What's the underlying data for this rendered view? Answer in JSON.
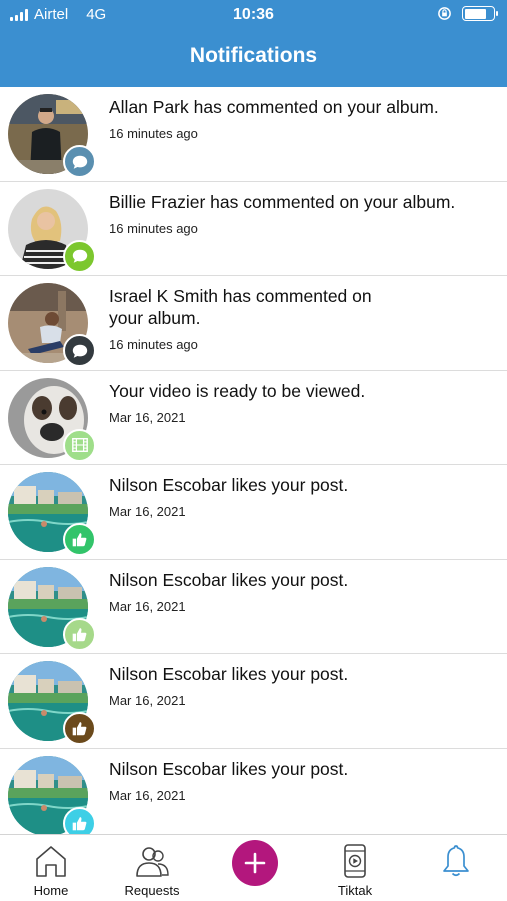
{
  "status_bar": {
    "carrier": "Airtel",
    "network": "4G",
    "time": "10:36"
  },
  "header": {
    "title": "Notifications"
  },
  "colors": {
    "header_bg": "#3b8fd0",
    "add_button": "#b3177d",
    "active_tab": "#3b8fd0"
  },
  "notifications": [
    {
      "message": "Allan Park has commented on your album.",
      "time": "16 minutes ago",
      "badge_icon": "comment-icon",
      "badge_color": "#5a8fb0"
    },
    {
      "message": "Billie Frazier has commented on your album.",
      "time": "16 minutes ago",
      "badge_icon": "comment-icon",
      "badge_color": "#7cc72e"
    },
    {
      "message": "Israel K Smith has commented on your album.",
      "time": "16 minutes ago",
      "badge_icon": "comment-icon",
      "badge_color": "#333a3f"
    },
    {
      "message": "Your video is ready to be viewed.",
      "time": "Mar 16, 2021",
      "badge_icon": "film-icon",
      "badge_color": "#9fde8a"
    },
    {
      "message": "Nilson Escobar likes your post.",
      "time": "Mar 16, 2021",
      "badge_icon": "thumbs-up-icon",
      "badge_color": "#32c46a"
    },
    {
      "message": "Nilson Escobar likes your post.",
      "time": "Mar 16, 2021",
      "badge_icon": "thumbs-up-icon",
      "badge_color": "#a6d98a"
    },
    {
      "message": "Nilson Escobar likes your post.",
      "time": "Mar 16, 2021",
      "badge_icon": "thumbs-up-icon",
      "badge_color": "#6b4a1c"
    },
    {
      "message": "Nilson Escobar likes your post.",
      "time": "Mar 16, 2021",
      "badge_icon": "thumbs-up-icon",
      "badge_color": "#3ecfe6"
    }
  ],
  "tabbar": {
    "home": "Home",
    "requests": "Requests",
    "tiktak": "Tiktak"
  }
}
